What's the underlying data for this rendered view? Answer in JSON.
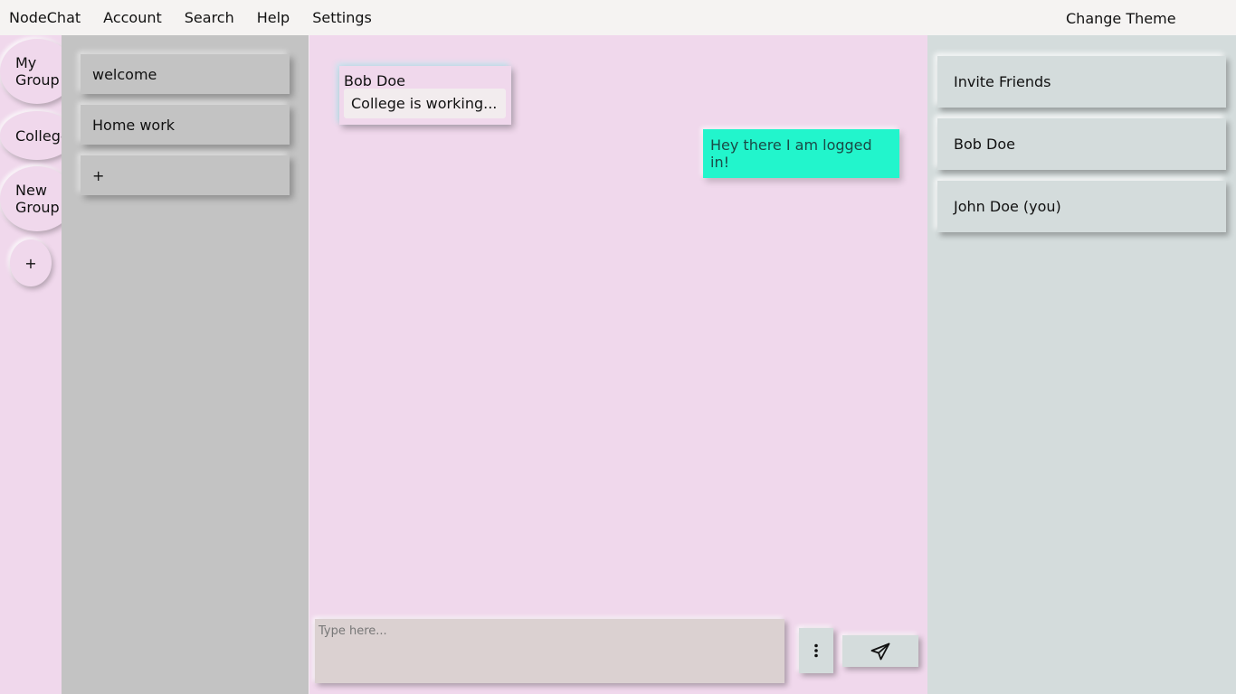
{
  "menu": {
    "brand": "NodeChat",
    "items": [
      "Account",
      "Search",
      "Help",
      "Settings"
    ],
    "change_theme": "Change Theme"
  },
  "groups": {
    "items": [
      "My\nGroup",
      "College",
      "New\nGroup"
    ],
    "add_label": "+"
  },
  "channels": {
    "items": [
      "welcome",
      "Home work"
    ],
    "add_label": "+"
  },
  "chat": {
    "incoming": {
      "author": "Bob Doe",
      "text": "College is working..."
    },
    "outgoing": {
      "text": "Hey there I am logged in!"
    },
    "composer_placeholder": "Type here...",
    "more_icon": "vertical-ellipsis",
    "send_icon": "paper-plane"
  },
  "members": {
    "items": [
      "Invite Friends",
      "Bob Doe",
      "John Doe (you)"
    ]
  },
  "colors": {
    "pink_bg": "#f0d8ec",
    "channel_bg": "#c3c3c3",
    "members_bg": "#d4dcdc",
    "outgoing_bubble": "#22f5cc",
    "composer_bg": "#dbd1d1",
    "topbar_bg": "#f5f3f2"
  }
}
